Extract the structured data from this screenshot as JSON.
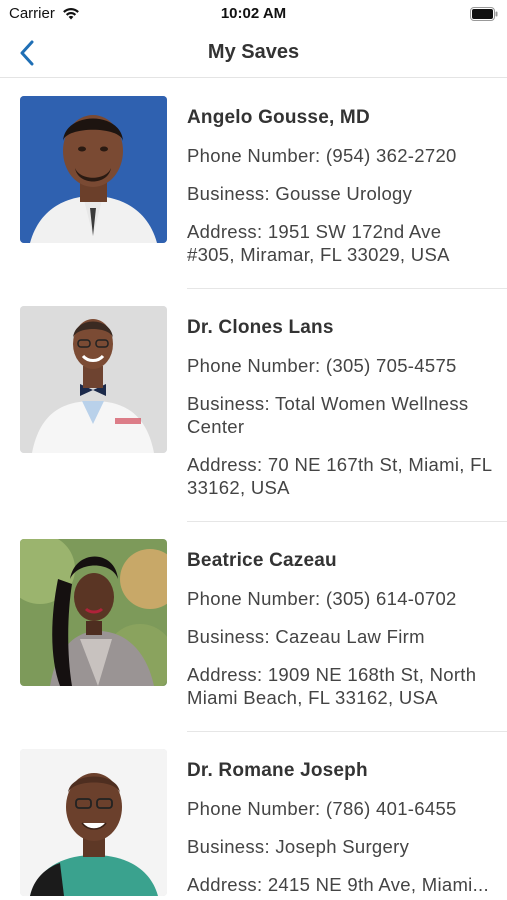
{
  "status_bar": {
    "carrier": "Carrier",
    "time": "10:02 AM"
  },
  "nav": {
    "title": "My Saves",
    "back_icon": "chevron-left-icon",
    "accent_color": "#1f6fb5"
  },
  "contacts": [
    {
      "name": "Angelo Gousse, MD",
      "phone": "Phone Number: (954) 362-2720",
      "business": "Business: Gousse Urology",
      "address": "Address: 1951 SW 172nd Ave #305, Miramar, FL 33029, USA"
    },
    {
      "name": "Dr. Clones Lans",
      "phone": "Phone Number: (305) 705-4575",
      "business": "Business: Total Women Wellness Center",
      "address": "Address: 70 NE 167th St, Miami, FL 33162, USA"
    },
    {
      "name": "Beatrice Cazeau",
      "phone": "Phone Number: (305) 614-0702",
      "business": "Business: Cazeau Law Firm",
      "address": "Address: 1909 NE 168th St, North Miami Beach, FL 33162, USA"
    },
    {
      "name": "Dr. Romane Joseph",
      "phone": "Phone Number: (786) 401-6455",
      "business": "Business: Joseph Surgery",
      "address": "Address: 2415 NE 9th Ave, Miami..."
    }
  ]
}
